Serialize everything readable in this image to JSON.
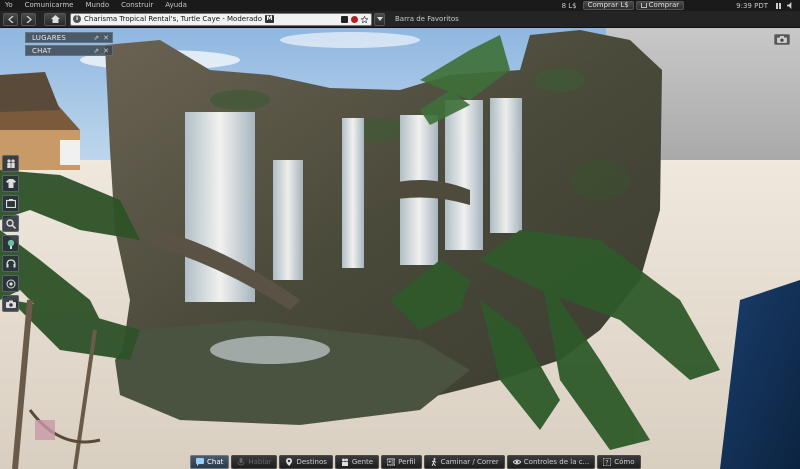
{
  "menu": {
    "items": [
      "Yo",
      "Comunicarme",
      "Mundo",
      "Construir",
      "Ayuda"
    ],
    "balance": "8 L$",
    "buy_lindens": "Comprar L$",
    "shop": "Comprar",
    "time": "9:39 PDT"
  },
  "navbar": {
    "location": "Charisma Tropical Rental's, Turtle Caye - Moderado",
    "maturity_badge": "M",
    "favorites_label": "Barra de Favoritos"
  },
  "floaters": {
    "places_label": "LUGARES",
    "chat_label": "CHAT",
    "ctrl_pin": "⇗",
    "ctrl_close": "✕"
  },
  "left_toolbar": {
    "icons": [
      "people-icon",
      "appearance-icon",
      "inventory-icon",
      "search-icon",
      "avatar-icon",
      "voice-icon",
      "mini-map-icon",
      "snapshot-icon"
    ]
  },
  "bottom_bar": {
    "chat": "Chat",
    "speak": "Hablar",
    "destinations": "Destinos",
    "people": "Gente",
    "profile": "Perfil",
    "walk": "Caminar / Correr",
    "camera": "Controles de la c...",
    "how_to": "Cómo"
  },
  "colors": {
    "menu_bg": "#1a1a1a",
    "panel_bg": "#3c4650",
    "accent": "#4a5a6a"
  }
}
